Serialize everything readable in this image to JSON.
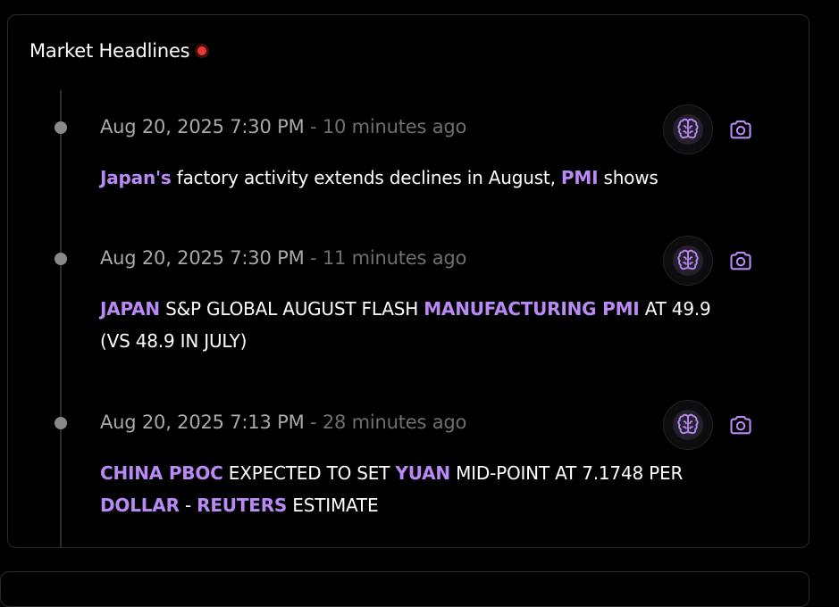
{
  "panel": {
    "title": "Market Headlines",
    "live_color": "#e53935"
  },
  "colors": {
    "highlight": "#b98af5",
    "timestamp": "#a9a9a9",
    "relative_time": "#6f6f6f",
    "text": "#ffffff",
    "background": "#000000"
  },
  "items": [
    {
      "timestamp": "Aug 20, 2025 7:30 PM",
      "separator": " - ",
      "ago": "10 minutes ago",
      "headline": [
        {
          "text": "Japan's",
          "highlight": true
        },
        {
          "text": " factory activity extends declines in August, ",
          "highlight": false
        },
        {
          "text": "PMI",
          "highlight": true
        },
        {
          "text": " shows",
          "highlight": false
        }
      ],
      "actions": [
        "brain-icon",
        "camera-icon"
      ]
    },
    {
      "timestamp": "Aug 20, 2025 7:30 PM",
      "separator": " - ",
      "ago": "11 minutes ago",
      "headline": [
        {
          "text": "JAPAN",
          "highlight": true
        },
        {
          "text": " S&P GLOBAL AUGUST FLASH ",
          "highlight": false
        },
        {
          "text": "MANUFACTURING PMI",
          "highlight": true
        },
        {
          "text": " AT 49.9 (VS 48.9 IN JULY)",
          "highlight": false
        }
      ],
      "actions": [
        "brain-icon",
        "camera-icon"
      ]
    },
    {
      "timestamp": "Aug 20, 2025 7:13 PM",
      "separator": " - ",
      "ago": "28 minutes ago",
      "headline": [
        {
          "text": "CHINA PBOC",
          "highlight": true
        },
        {
          "text": " EXPECTED TO SET ",
          "highlight": false
        },
        {
          "text": "YUAN",
          "highlight": true
        },
        {
          "text": " MID-POINT AT 7.1748 PER ",
          "highlight": false
        },
        {
          "text": "DOLLAR",
          "highlight": true
        },
        {
          "text": " - ",
          "highlight": false
        },
        {
          "text": "REUTERS",
          "highlight": true
        },
        {
          "text": " ESTIMATE",
          "highlight": false
        }
      ],
      "actions": [
        "brain-icon",
        "camera-icon"
      ]
    }
  ]
}
